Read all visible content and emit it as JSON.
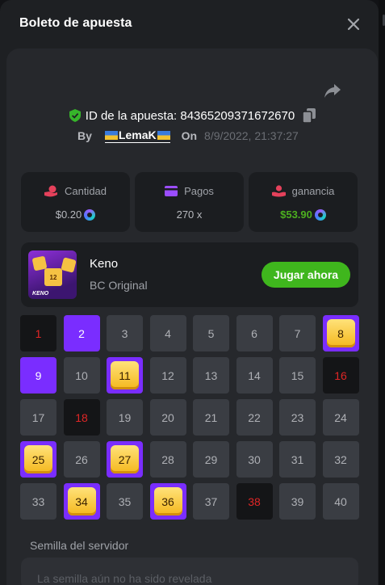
{
  "modal": {
    "title": "Boleto de apuesta"
  },
  "bet": {
    "id_text": "ID de la apuesta: 84365209371672670",
    "by_label": "By",
    "username": "LemaK",
    "on_label": "On",
    "date": "8/9/2022, 21:37:27"
  },
  "stats": [
    {
      "label": "Cantidad",
      "value": "$0.20",
      "icon": "coins-hand-icon",
      "value_color": "#b7b9be"
    },
    {
      "label": "Pagos",
      "value": "270 x",
      "icon": "card-icon",
      "value_color": "#b7b9be"
    },
    {
      "label": "ganancia",
      "value": "$53.90",
      "icon": "profit-icon",
      "value_color": "#4caf1f"
    }
  ],
  "game": {
    "name": "Keno",
    "subtitle": "BC Original",
    "thumb_number": "12",
    "thumb_word": "KENO",
    "play_label": "Jugar ahora"
  },
  "keno_grid": {
    "numbers": [
      1,
      2,
      3,
      4,
      5,
      6,
      7,
      8,
      9,
      10,
      11,
      12,
      13,
      14,
      15,
      16,
      17,
      18,
      19,
      20,
      21,
      22,
      23,
      24,
      25,
      26,
      27,
      28,
      29,
      30,
      31,
      32,
      33,
      34,
      35,
      36,
      37,
      38,
      39,
      40
    ],
    "selected": [
      2,
      9
    ],
    "hits": [
      8,
      11,
      25,
      27,
      34,
      36
    ],
    "misses": [
      1,
      16,
      18,
      38
    ]
  },
  "seed": {
    "label": "Semilla del servidor",
    "placeholder": "La semilla aún no ha sido revelada"
  },
  "colors": {
    "accent_purple": "#7a2dff",
    "play_green": "#3fb61d",
    "profit_green": "#4caf1f",
    "miss_red": "#e02626",
    "gem_gold": "#f4b71c"
  }
}
